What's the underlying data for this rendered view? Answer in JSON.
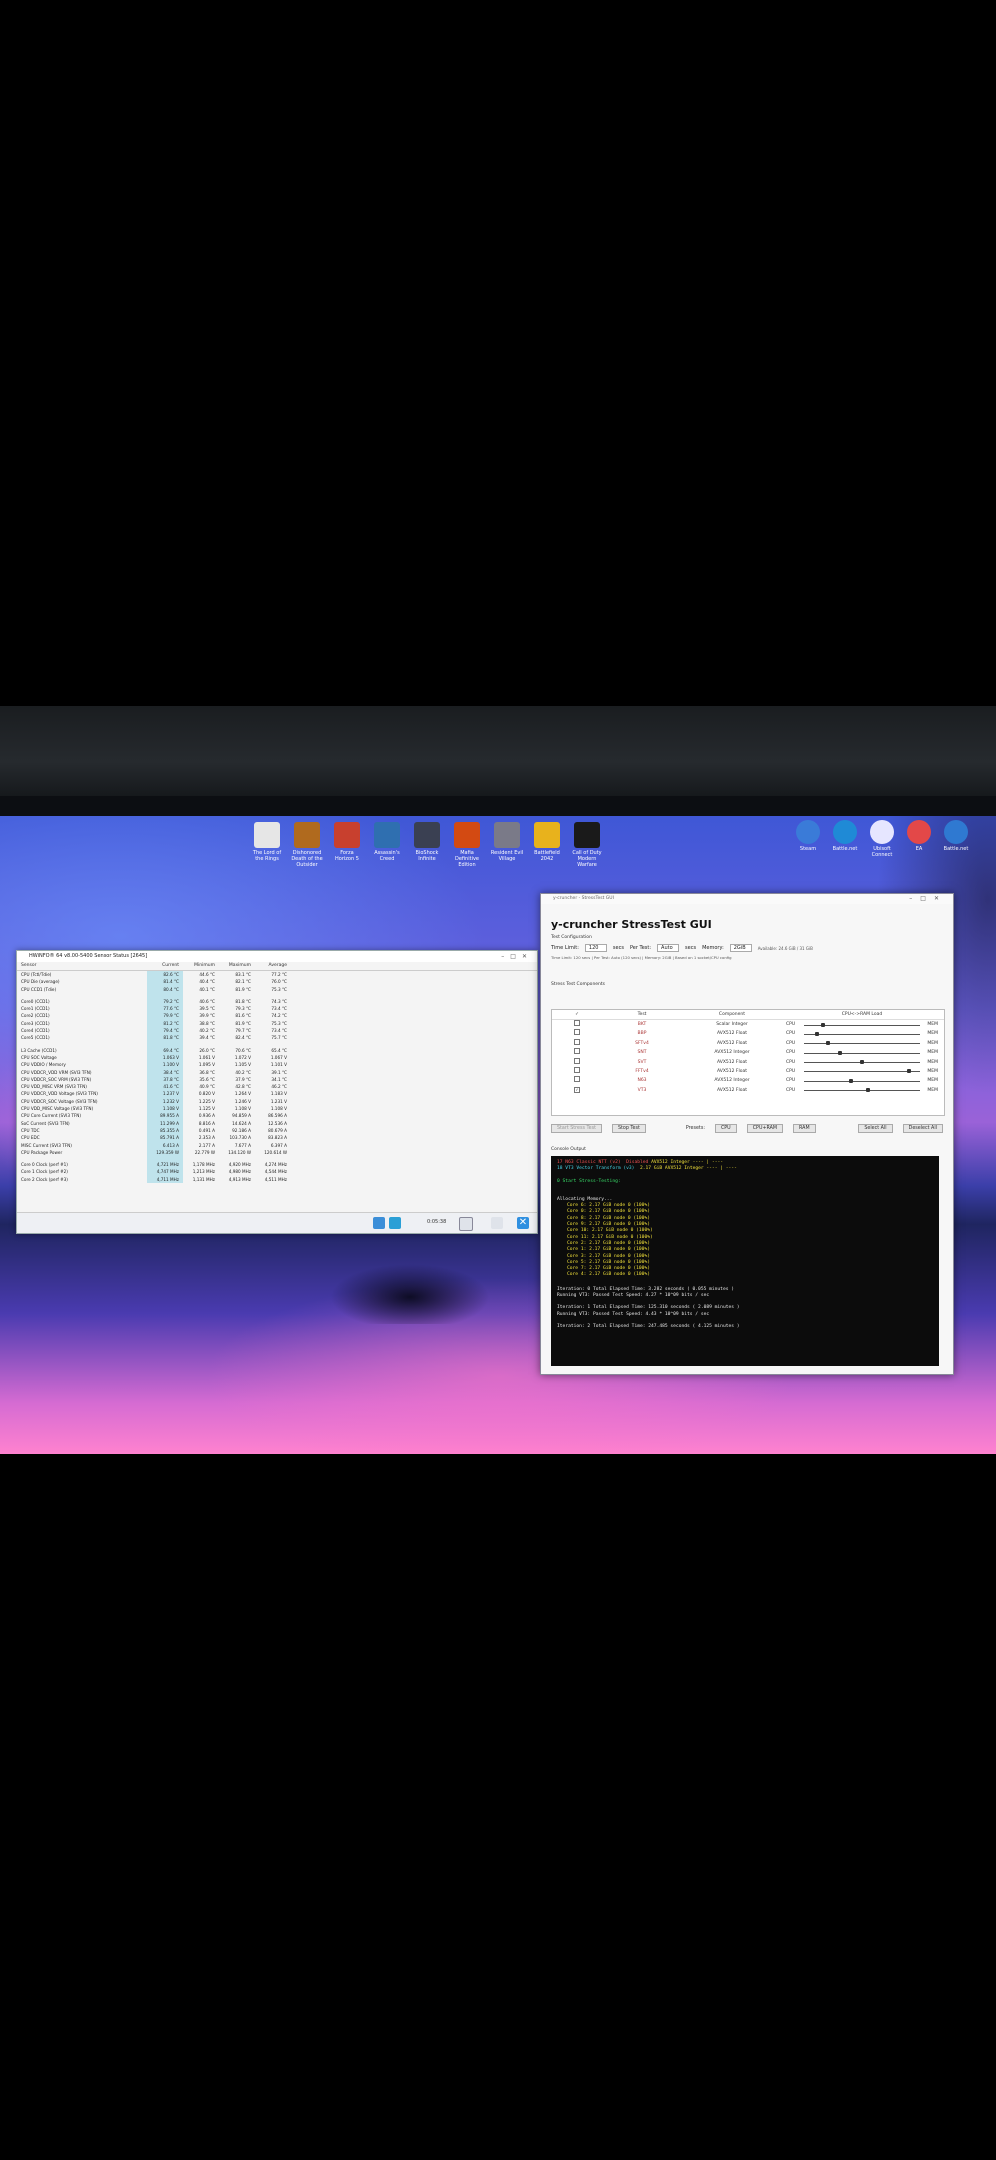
{
  "desktop": {
    "icons_left": [
      {
        "label": "The Lord of the Rings",
        "color": "#e6e6e6"
      },
      {
        "label": "Dishonored Death of the Outsider",
        "color": "#b06a1e"
      },
      {
        "label": "Forza Horizon 5",
        "color": "#c8402e"
      },
      {
        "label": "Assassin's Creed",
        "color": "#2f6fb0"
      },
      {
        "label": "BioShock Infinite",
        "color": "#3a4052"
      },
      {
        "label": "Mafia Definitive Edition",
        "color": "#d34a12"
      },
      {
        "label": "Resident Evil Village",
        "color": "#7a7a88"
      },
      {
        "label": "Battlefield 2042",
        "color": "#e8b21c"
      },
      {
        "label": "Call of Duty Modern Warfare",
        "color": "#1a1a1a"
      }
    ],
    "icons_right": [
      {
        "label": "Steam",
        "color": "#3a7bd8"
      },
      {
        "label": "Battle.net",
        "color": "#1f8ad6"
      },
      {
        "label": "Ubisoft Connect",
        "color": "#e6e6ff"
      },
      {
        "label": "EA",
        "color": "#e34848"
      },
      {
        "label": "Battle.net",
        "color": "#2f79d1"
      }
    ]
  },
  "hwinfo": {
    "title": "HWiNFO® 64 v8.00-5400 Sensor Status [2645]",
    "columns": [
      "Sensor",
      "Current",
      "Minimum",
      "Maximum",
      "Average"
    ],
    "rows": [
      [
        "CPU (Tctl/Tdie)",
        "82.6 °C",
        "44.6 °C",
        "83.1 °C",
        "77.2 °C"
      ],
      [
        "CPU Die (average)",
        "81.4 °C",
        "40.4 °C",
        "82.1 °C",
        "76.0 °C"
      ],
      [
        "CPU CCD1 (Tdie)",
        "80.4 °C",
        "40.1 °C",
        "81.9 °C",
        "75.3 °C"
      ],
      [
        "",
        "",
        "",
        "",
        ""
      ],
      [
        "Core0 (CCD1)",
        "79.2 °C",
        "40.6 °C",
        "81.8 °C",
        "74.3 °C"
      ],
      [
        "Core1 (CCD1)",
        "77.6 °C",
        "39.5 °C",
        "79.3 °C",
        "73.4 °C"
      ],
      [
        "Core2 (CCD1)",
        "79.9 °C",
        "39.9 °C",
        "81.6 °C",
        "74.2 °C"
      ],
      [
        "Core3 (CCD1)",
        "81.2 °C",
        "38.8 °C",
        "81.9 °C",
        "75.3 °C"
      ],
      [
        "Core4 (CCD1)",
        "79.4 °C",
        "40.2 °C",
        "79.7 °C",
        "73.4 °C"
      ],
      [
        "Core5 (CCD1)",
        "81.8 °C",
        "39.4 °C",
        "82.4 °C",
        "75.7 °C"
      ],
      [
        "",
        "",
        "",
        "",
        ""
      ],
      [
        "L3 Cache (CCD1)",
        "69.4 °C",
        "26.0 °C",
        "70.6 °C",
        "65.4 °C"
      ],
      [
        "CPU SOC Voltage",
        "1.063 V",
        "1.061 V",
        "1.072 V",
        "1.067 V"
      ],
      [
        "CPU VDDIO / Memory",
        "1.100 V",
        "1.095 V",
        "1.105 V",
        "1.101 V"
      ],
      [
        "CPU VDDCR_VDD VRM (SVI3 TFN)",
        "38.4 °C",
        "36.8 °C",
        "40.2 °C",
        "39.1 °C"
      ],
      [
        "CPU VDDCR_SOC VRM (SVI3 TFN)",
        "37.8 °C",
        "35.6 °C",
        "37.9 °C",
        "34.1 °C"
      ],
      [
        "CPU VDD_MISC VRM (SVI3 TFN)",
        "41.6 °C",
        "40.9 °C",
        "42.8 °C",
        "46.2 °C"
      ],
      [
        "CPU VDDCR_VDD Voltage (SVI3 TFN)",
        "1.237 V",
        "0.820 V",
        "1.264 V",
        "1.183 V"
      ],
      [
        "CPU VDDCR_SOC Voltage (SVI3 TFN)",
        "1.232 V",
        "1.225 V",
        "1.246 V",
        "1.231 V"
      ],
      [
        "CPU VDD_MISC Voltage (SVI3 TFN)",
        "1.108 V",
        "1.125 V",
        "1.108 V",
        "1.108 V"
      ],
      [
        "CPU Core Current (SVI3 TFN)",
        "89.955 A",
        "0.936 A",
        "94.859 A",
        "86.596 A"
      ],
      [
        "SoC Current (SVI3 TFN)",
        "11.299 A",
        "8.816 A",
        "14.624 A",
        "12.536 A"
      ],
      [
        "CPU TDC",
        "85.355 A",
        "0.491 A",
        "92.186 A",
        "80.679 A"
      ],
      [
        "CPU EDC",
        "85.791 A",
        "2.353 A",
        "103.730 A",
        "83.823 A"
      ],
      [
        "MISC Current (SVI3 TFN)",
        "6.413 A",
        "2.177 A",
        "7.677 A",
        "6.397 A"
      ],
      [
        "CPU Package Power",
        "129.359 W",
        "22.779 W",
        "134.120 W",
        "120.614 W"
      ],
      [
        "",
        "",
        "",
        "",
        ""
      ],
      [
        "Core 0 Clock (perf #1)",
        "4,721 MHz",
        "1,178 MHz",
        "4,920 MHz",
        "4,274 MHz"
      ],
      [
        "Core 1 Clock (perf #2)",
        "4,747 MHz",
        "1,213 MHz",
        "4,980 MHz",
        "4,544 MHz"
      ],
      [
        "Core 2 Clock (perf #3)",
        "4,711 MHz",
        "1,131 MHz",
        "4,913 MHz",
        "4,511 MHz"
      ]
    ],
    "elapsed": "0:05:38"
  },
  "ycruncher": {
    "window_title": "y-cruncher - StressTest GUI",
    "heading": "y-cruncher StressTest GUI",
    "section_config": "Test Configuration",
    "time_limit_label": "Time Limit:",
    "time_limit_value": "120",
    "time_limit_unit": "secs",
    "per_test_label": "Per Test:",
    "per_test_value": "Auto",
    "per_test_unit": "secs",
    "memory_label": "Memory:",
    "memory_value": "2GiB",
    "memory_note": "Available: 24.6 GiB / 31 GiB",
    "config_note": "Time Limit: 120 secs | Per Test: Auto (120 secs) | Memory: 2GiB | Based on 1 socket/CPU config",
    "section_components": "Stress Test Components",
    "table_headers": [
      "✓",
      "Test",
      "Component",
      "CPU<->RAM Load"
    ],
    "tests": [
      {
        "test": "BKT",
        "component": "Scalar Integer",
        "slider": 0.15,
        "checked": false
      },
      {
        "test": "BBP",
        "component": "AVX512 Float",
        "slider": 0.1,
        "checked": false
      },
      {
        "test": "SFTv4",
        "component": "AVX512 Float",
        "slider": 0.2,
        "checked": false
      },
      {
        "test": "SNT",
        "component": "AVX512 Integer",
        "slider": 0.3,
        "checked": false
      },
      {
        "test": "SVT",
        "component": "AVX512 Float",
        "slider": 0.5,
        "checked": false
      },
      {
        "test": "FFTv4",
        "component": "AVX512 Float",
        "slider": 0.92,
        "checked": false
      },
      {
        "test": "N63",
        "component": "AVX512 Integer",
        "slider": 0.4,
        "checked": false
      },
      {
        "test": "VT3",
        "component": "AVX512 Float",
        "slider": 0.55,
        "checked": true
      }
    ],
    "load_left": "CPU",
    "load_right": "MEM",
    "start_label": "Start Stress Test",
    "stop_label": "Stop Test",
    "presets_label": "Presets:",
    "preset_cpu": "CPU",
    "preset_cpu_ram": "CPU+RAM",
    "preset_ram": "RAM",
    "select_all": "Select All",
    "deselect_all": "Deselect All",
    "console_label": "Console Output",
    "console": {
      "line17": "17  N63   Classic NTT (v2)",
      "line17_status": "Disabled",
      "line17_comp": "AVX512 Integer  ---- | ----",
      "line18": "18  VT3   Vector Transform (v3)",
      "line18_status": "2.17 GiB",
      "line18_comp": "AVX512 Integer  ---- | ----",
      "start": "0   Start Stress-Testing:",
      "allocating": "Allocating Memory...",
      "cores": [
        "Core  6:  2.17 GiB  node 0 (100%)",
        "Core  0:  2.17 GiB  node 0 (100%)",
        "Core  8:  2.17 GiB  node 0 (100%)",
        "Core  9:  2.17 GiB  node 0 (100%)",
        "Core 10:  2.17 GiB  node 0 (100%)",
        "Core 11:  2.17 GiB  node 0 (100%)",
        "Core  2:  2.17 GiB  node 0 (100%)",
        "Core  1:  2.17 GiB  node 0 (100%)",
        "Core  3:  2.17 GiB  node 0 (100%)",
        "Core  5:  2.17 GiB  node 0 (100%)",
        "Core  7:  2.17 GiB  node 0 (100%)",
        "Core  4:  2.17 GiB  node 0 (100%)"
      ],
      "iter0": "Iteration: 0  Total Elapsed Time: 3.282 seconds  ( 0.055 minutes )",
      "iter0_run": "Running VT3: Passed  Test Speed:  4.27 * 10^09  bits / sec",
      "iter1": "Iteration: 1  Total Elapsed Time: 125.310 seconds  ( 2.089 minutes )",
      "iter1_run": "Running VT3: Passed  Test Speed:  4.43 * 10^09  bits / sec",
      "iter2": "Iteration: 2  Total Elapsed Time: 247.485 seconds  ( 4.125 minutes )"
    }
  }
}
